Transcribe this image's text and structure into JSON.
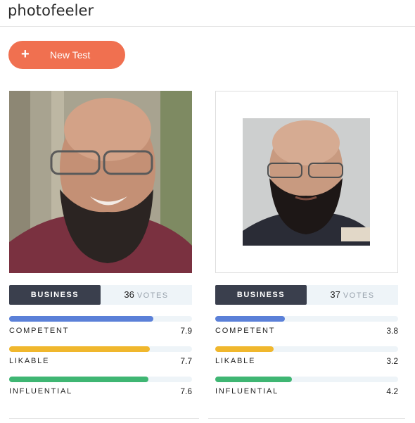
{
  "app": {
    "logo": "photofeeler"
  },
  "toolbar": {
    "new_test_icon": "+",
    "new_test_label": "New Test"
  },
  "cards": [
    {
      "category": "BUSINESS",
      "votes": "36",
      "votes_label": "VOTES",
      "metrics": [
        {
          "label": "COMPETENT",
          "score": "7.9",
          "fill": 0.79,
          "color": "#5b80d8"
        },
        {
          "label": "LIKABLE",
          "score": "7.7",
          "fill": 0.77,
          "color": "#f0b72d"
        },
        {
          "label": "INFLUENTIAL",
          "score": "7.6",
          "fill": 0.76,
          "color": "#3fb673"
        }
      ]
    },
    {
      "category": "BUSINESS",
      "votes": "37",
      "votes_label": "VOTES",
      "metrics": [
        {
          "label": "COMPETENT",
          "score": "3.8",
          "fill": 0.38,
          "color": "#5b80d8"
        },
        {
          "label": "LIKABLE",
          "score": "3.2",
          "fill": 0.32,
          "color": "#f0b72d"
        },
        {
          "label": "INFLUENTIAL",
          "score": "4.2",
          "fill": 0.42,
          "color": "#3fb673"
        }
      ]
    }
  ]
}
